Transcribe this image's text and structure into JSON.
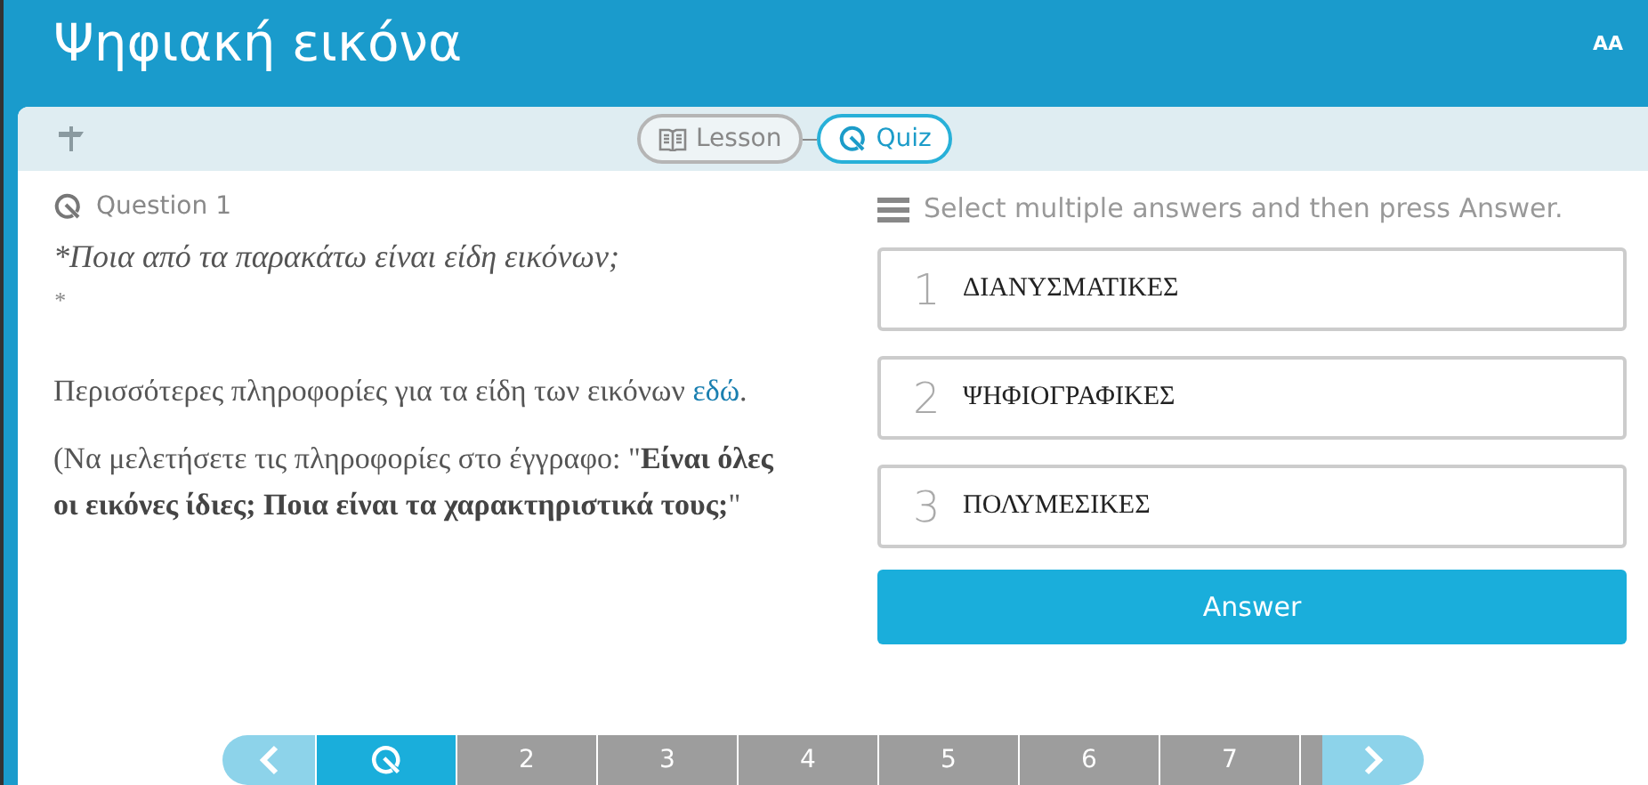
{
  "header": {
    "title": "Ψηφιακή εικόνα",
    "font_button": "AA"
  },
  "toolbar": {
    "tabs": [
      {
        "label": "Lesson",
        "kind": "lesson",
        "selected": false
      },
      {
        "label": "Quiz",
        "kind": "quiz",
        "selected": true
      }
    ]
  },
  "question": {
    "heading": "Question 1",
    "prompt_lines": [
      "*Ποια από τα παρακάτω είναι είδη εικόνων;",
      "*"
    ],
    "info": {
      "text": "Περισσότερες πληροφορίες για τα είδη των εικόνων ",
      "link": "εδώ",
      "after": "."
    },
    "note": "(Να μελετήσετε τις πληροφορίες στο έγγραφο: \"**Είναι όλες οι εικόνες ίδιες; Ποια είναι τα χαρακτηριστικά τους;**\""
  },
  "answers": {
    "instruction": "Select multiple answers and then press Answer.",
    "options": [
      {
        "number": "1",
        "text": "ΔΙΑΝΥΣΜΑΤΙΚΕΣ"
      },
      {
        "number": "2",
        "text": "ΨΗΦΙΟΓΡΑΦΙΚΕΣ"
      },
      {
        "number": "3",
        "text": "ΠΟΛΥΜΕΣΙΚΕΣ"
      }
    ],
    "button": "Answer"
  },
  "pager": {
    "items": [
      {
        "kind": "quiz",
        "selected": true
      },
      {
        "kind": "number",
        "label": "2",
        "selected": false
      },
      {
        "kind": "number",
        "label": "3",
        "selected": false
      },
      {
        "kind": "number",
        "label": "4",
        "selected": false
      },
      {
        "kind": "number",
        "label": "5",
        "selected": false
      },
      {
        "kind": "number",
        "label": "6",
        "selected": false
      },
      {
        "kind": "number",
        "label": "7",
        "selected": false
      }
    ]
  }
}
